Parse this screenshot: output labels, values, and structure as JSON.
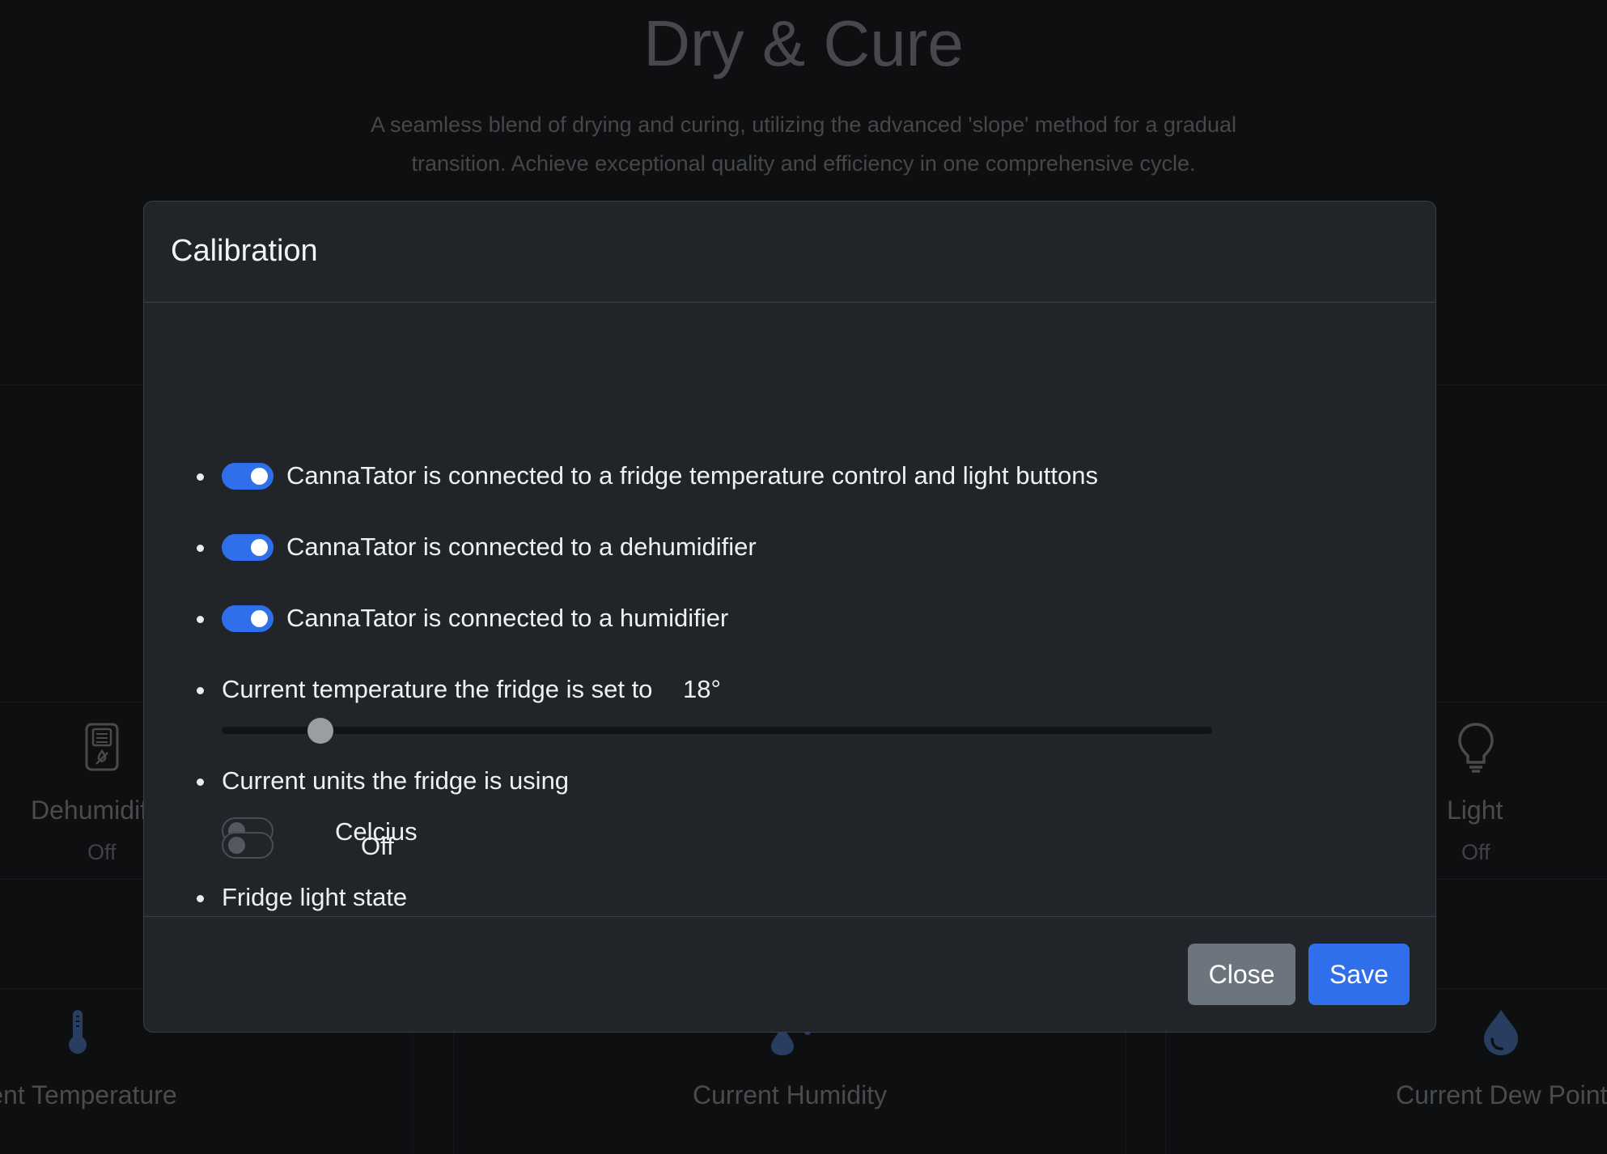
{
  "background": {
    "title": "Dry & Cure",
    "subtitle": "A seamless blend of drying and curing, utilizing the advanced 'slope' method for a gradual transition. Achieve exceptional quality and efficiency in one comprehensive cycle.",
    "tiles": [
      {
        "label": "Dehumidifier",
        "value": "Off",
        "icon": "dehumidifier-icon"
      },
      {
        "label": "Light",
        "value": "Off",
        "icon": "lightbulb-icon"
      }
    ],
    "readings": [
      {
        "label": "Current Temperature",
        "icon": "thermometer-icon"
      },
      {
        "label": "Current Humidity",
        "icon": "humidity-icon"
      },
      {
        "label": "Current Dew Point",
        "icon": "droplet-icon"
      }
    ]
  },
  "modal": {
    "title": "Calibration",
    "options": [
      {
        "label": "CannaTator is connected to a fridge temperature control and light buttons",
        "enabled": true
      },
      {
        "label": "CannaTator is connected to a dehumidifier",
        "enabled": true
      },
      {
        "label": "CannaTator is connected to a humidifier",
        "enabled": true
      }
    ],
    "temperature": {
      "label": "Current temperature the fridge is set to",
      "value_text": "18°",
      "value": 18,
      "slider_fraction": 0.1
    },
    "units": {
      "label": "Current units the fridge is using",
      "value": "Celcius",
      "enabled": false
    },
    "light": {
      "label": "Fridge light state",
      "value": "Off",
      "enabled": false
    },
    "buttons": {
      "close": "Close",
      "save": "Save"
    }
  },
  "colors": {
    "accent": "#2f6fec",
    "secondary": "#6c757d",
    "modal_bg": "#212429",
    "page_bg": "#15171a",
    "icon_blue": "#3f5f95"
  }
}
